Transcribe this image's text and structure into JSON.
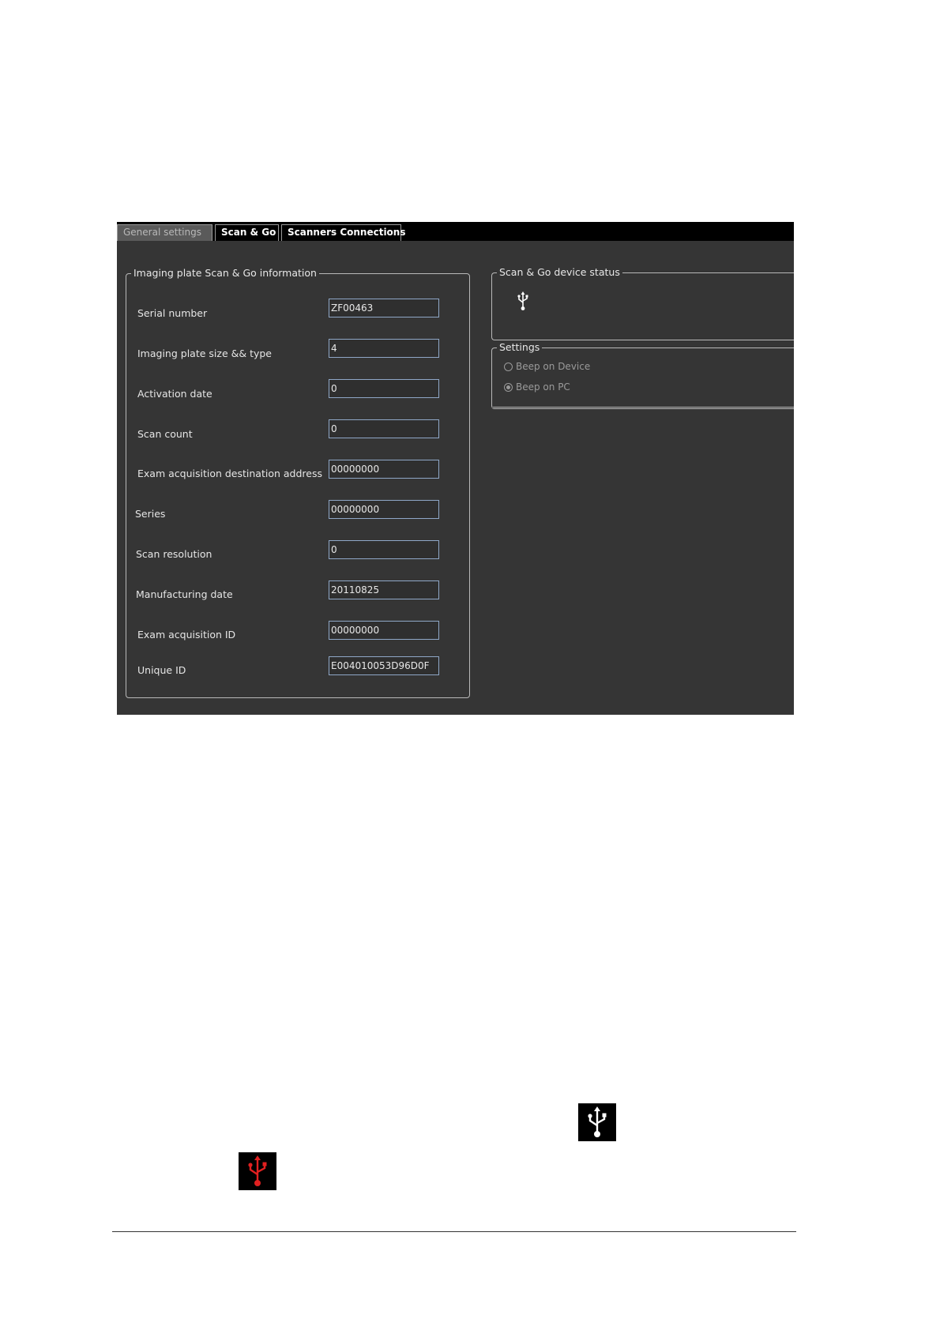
{
  "tabs": [
    {
      "label": "General settings",
      "active": false
    },
    {
      "label": "Scan & Go",
      "active": true
    },
    {
      "label": "Scanners Connections",
      "active": false
    }
  ],
  "info_group": {
    "title": "Imaging plate Scan & Go information",
    "fields": [
      {
        "label": "Serial number",
        "value": "ZF00463"
      },
      {
        "label": "Imaging plate size && type",
        "value": "4"
      },
      {
        "label": "Activation date",
        "value": "0"
      },
      {
        "label": "Scan count",
        "value": "0"
      },
      {
        "label": "Exam acquisition destination address",
        "value": "00000000"
      },
      {
        "label": "Series",
        "value": "00000000"
      },
      {
        "label": "Scan resolution",
        "value": "0"
      },
      {
        "label": "Manufacturing date",
        "value": "20110825"
      },
      {
        "label": "Exam acquisition ID",
        "value": "00000000"
      },
      {
        "label": "Unique ID",
        "value": "E004010053D96D0F"
      }
    ]
  },
  "status_group": {
    "title": "Scan & Go device status",
    "icon": "usb-icon"
  },
  "settings_group": {
    "title": "Settings",
    "options": [
      {
        "label": "Beep on Device",
        "checked": false
      },
      {
        "label": "Beep on PC",
        "checked": true
      }
    ]
  },
  "legend_icons": {
    "connected_icon": "usb-icon",
    "connected_color": "#ffffff",
    "disconnected_icon": "usb-icon",
    "disconnected_color": "#e02020"
  }
}
